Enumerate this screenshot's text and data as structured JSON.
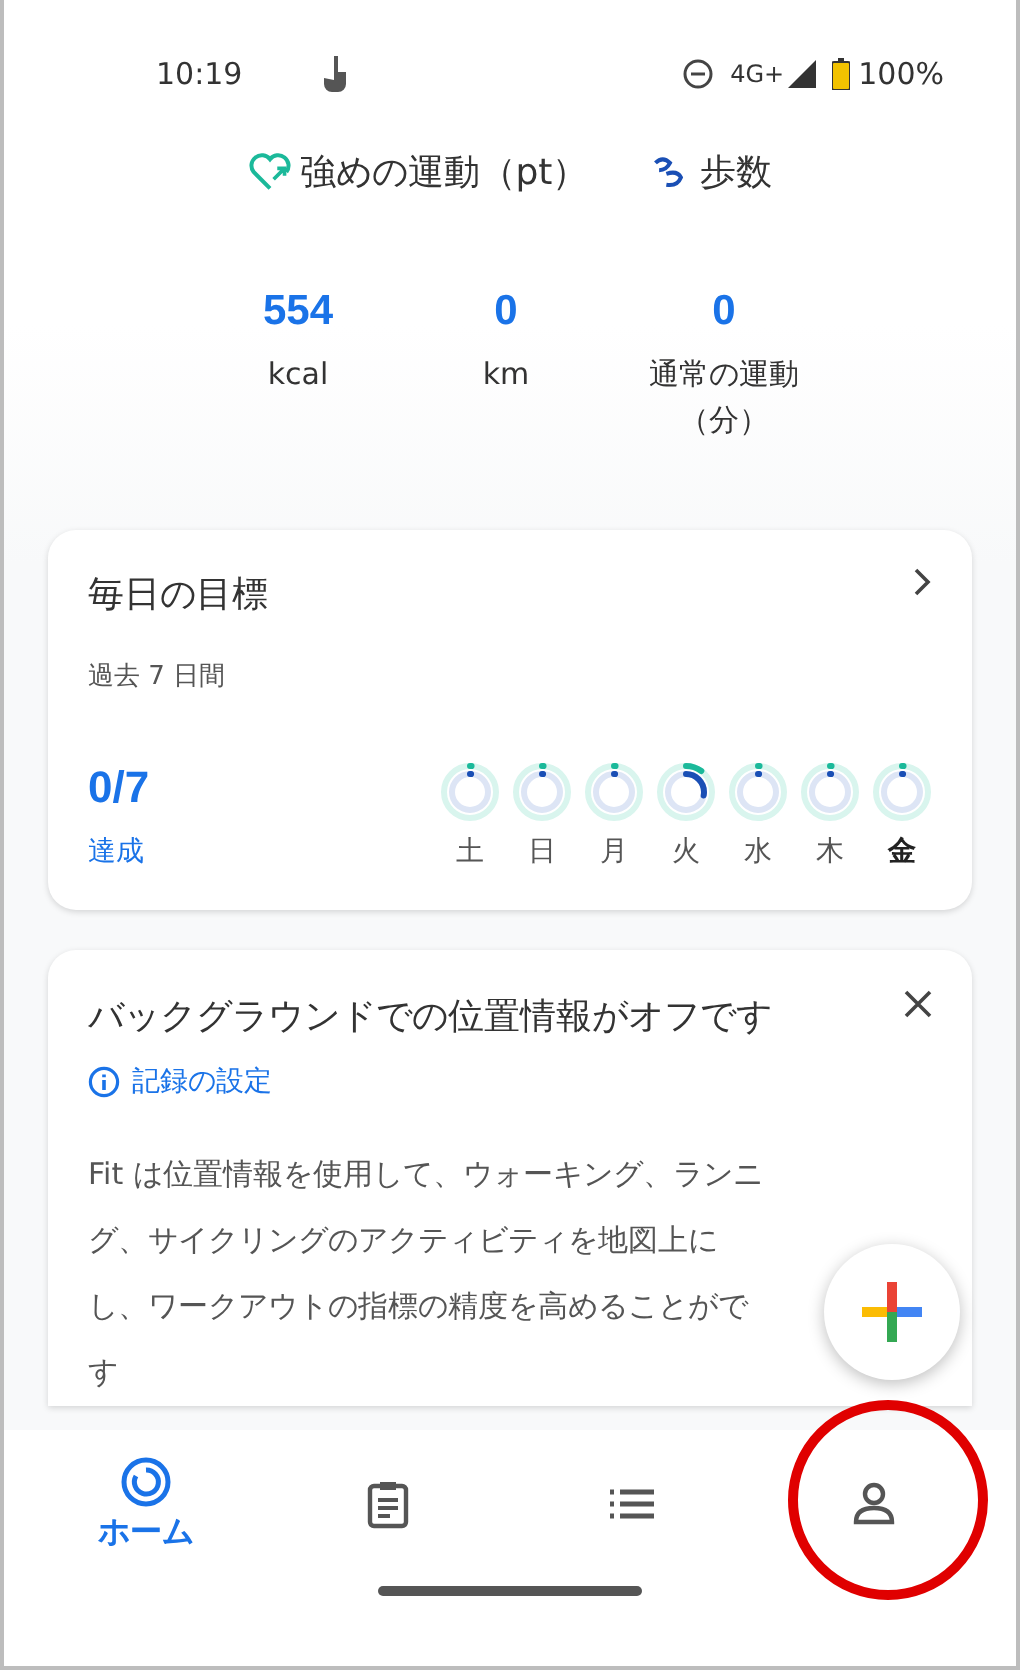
{
  "status_bar": {
    "time": "10:19",
    "battery": "100%",
    "network": "4G+"
  },
  "header": {
    "tabs": [
      {
        "kind": "heart",
        "label": "強めの運動（pt）"
      },
      {
        "kind": "steps",
        "label": "歩数"
      }
    ]
  },
  "stats": [
    {
      "value": "554",
      "label": "kcal"
    },
    {
      "value": "0",
      "label": "km"
    },
    {
      "value": "0",
      "label": "通常の運動（分）"
    }
  ],
  "daily_goals": {
    "title": "毎日の目標",
    "subtitle": "過去 7 日間",
    "count": "0/7",
    "count_label": "達成",
    "days": [
      {
        "label": "土",
        "kind": "empty",
        "today": false
      },
      {
        "label": "日",
        "kind": "empty",
        "today": false
      },
      {
        "label": "月",
        "kind": "empty",
        "today": false
      },
      {
        "label": "火",
        "kind": "partial",
        "today": false
      },
      {
        "label": "水",
        "kind": "empty",
        "today": false
      },
      {
        "label": "木",
        "kind": "empty",
        "today": false
      },
      {
        "label": "金",
        "kind": "empty",
        "today": true
      }
    ]
  },
  "location_card": {
    "title": "バックグラウンドでの位置情報がオフです",
    "link": "記録の設定",
    "body_lines": [
      "Fit は位置情報を使用して、ウォーキング、ランニ",
      "グ、サイクリングのアクティビティを地図上に",
      "し、ワークアウトの指標の精度を高めることがで",
      "す"
    ]
  },
  "nav": [
    {
      "kind": "home",
      "label": "ホーム",
      "selected": true
    },
    {
      "kind": "journal",
      "selected": false
    },
    {
      "kind": "browse",
      "selected": false
    },
    {
      "kind": "profile",
      "selected": false
    }
  ]
}
